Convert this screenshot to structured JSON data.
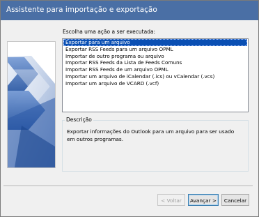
{
  "window": {
    "title": "Assistente para importação e exportação"
  },
  "main": {
    "prompt": "Escolha uma ação a ser executada:",
    "actions": [
      "Exportar para um arquivo",
      "Exportar RSS Feeds para um arquivo OPML",
      "Importar de outro programa ou arquivo",
      "Importar RSS Feeds da Lista de Feeds Comuns",
      "Importar RSS Feeds de um arquivo OPML",
      "Importar um arquivo de iCalendar (.ics) ou vCalendar (.vcs)",
      "Importar um arquivo de VCARD (.vcf)"
    ],
    "selected_index": 0,
    "description_label": "Descrição",
    "description_text": "Exportar informações do Outlook para um arquivo para ser usado em outros programas."
  },
  "buttons": {
    "back": "< Voltar",
    "next": "Avançar >",
    "cancel": "Cancelar"
  },
  "colors": {
    "titlebar": "#4a6fa5",
    "selection": "#0a4fb3"
  }
}
